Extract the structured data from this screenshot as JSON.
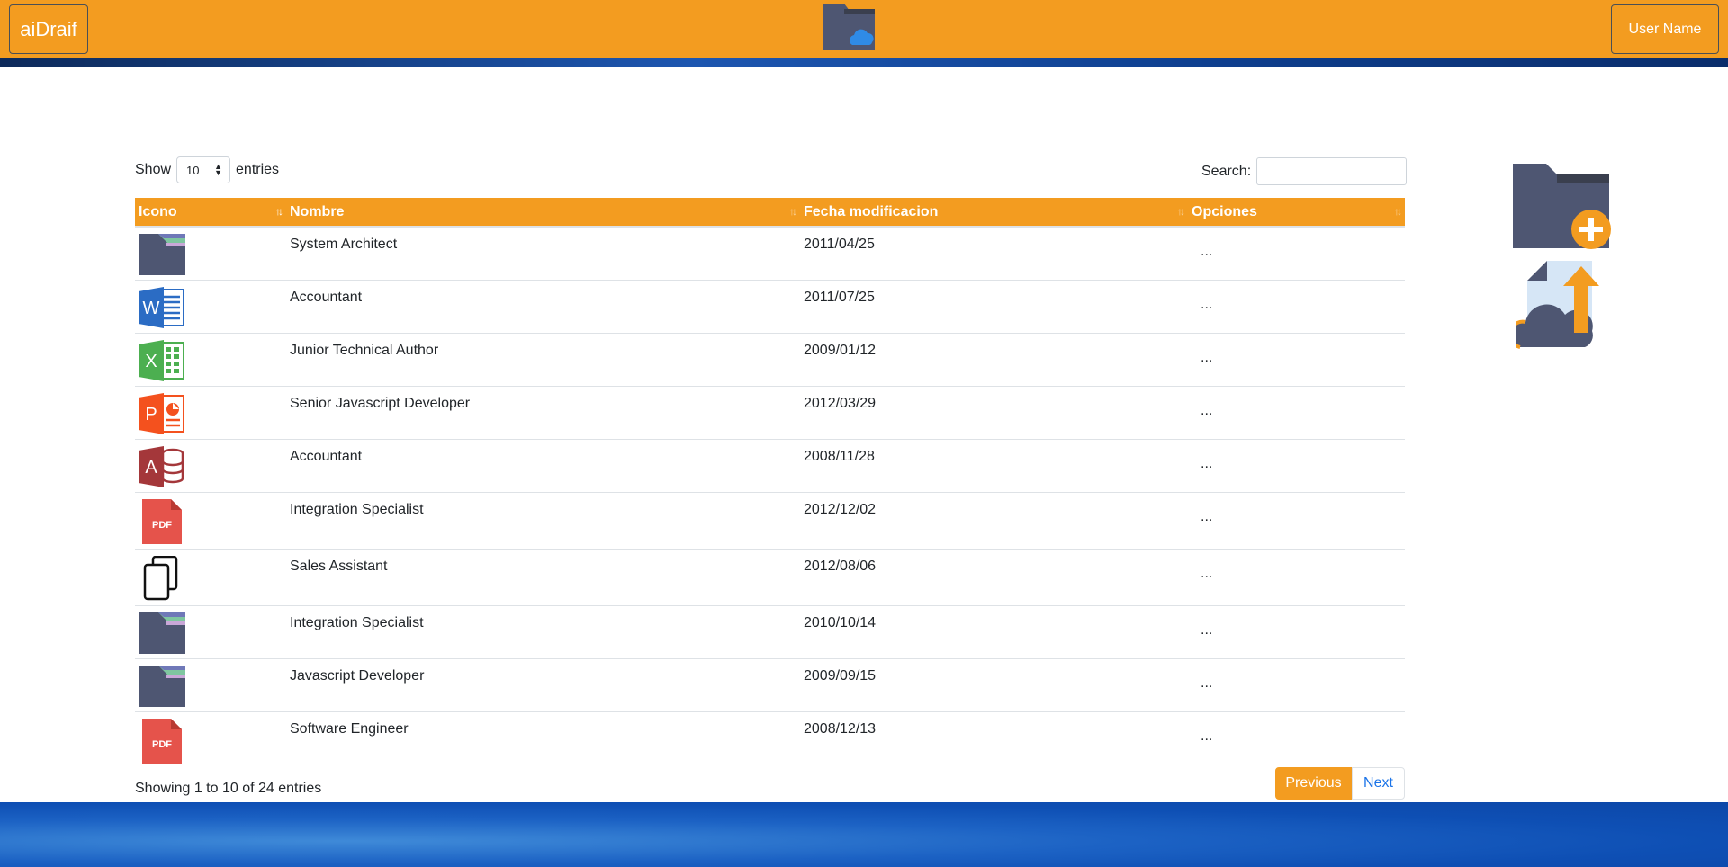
{
  "header": {
    "brand": "aiDraif",
    "user_button": "User Name"
  },
  "colors": {
    "accent": "#f39c20",
    "link": "#1a73e8",
    "folder": "#4e5672"
  },
  "controls": {
    "show_label": "Show",
    "entries_value": "10",
    "entries_label": "entries",
    "search_label": "Search:",
    "search_value": ""
  },
  "table": {
    "columns": [
      "Icono",
      "Nombre",
      "Fecha modificacion",
      "Opciones"
    ],
    "rows": [
      {
        "icon": "folder-icon",
        "name": "System Architect",
        "date": "2011/04/25",
        "options": "..."
      },
      {
        "icon": "word-icon",
        "name": "Accountant",
        "date": "2011/07/25",
        "options": "..."
      },
      {
        "icon": "excel-icon",
        "name": "Junior Technical Author",
        "date": "2009/01/12",
        "options": "..."
      },
      {
        "icon": "powerpoint-icon",
        "name": "Senior Javascript Developer",
        "date": "2012/03/29",
        "options": "..."
      },
      {
        "icon": "access-icon",
        "name": "Accountant",
        "date": "2008/11/28",
        "options": "..."
      },
      {
        "icon": "pdf-icon",
        "name": "Integration Specialist",
        "date": "2012/12/02",
        "options": "..."
      },
      {
        "icon": "copy-icon",
        "name": "Sales Assistant",
        "date": "2012/08/06",
        "options": "..."
      },
      {
        "icon": "folder-icon",
        "name": "Integration Specialist",
        "date": "2010/10/14",
        "options": "..."
      },
      {
        "icon": "folder-icon",
        "name": "Javascript Developer",
        "date": "2009/09/15",
        "options": "..."
      },
      {
        "icon": "pdf-icon",
        "name": "Software Engineer",
        "date": "2008/12/13",
        "options": "..."
      }
    ]
  },
  "footer": {
    "info": "Showing 1 to 10 of 24 entries",
    "previous": "Previous",
    "next": "Next"
  },
  "side_actions": {
    "new_folder_icon": "folder-add-icon",
    "upload_icon": "cloud-upload-icon"
  }
}
